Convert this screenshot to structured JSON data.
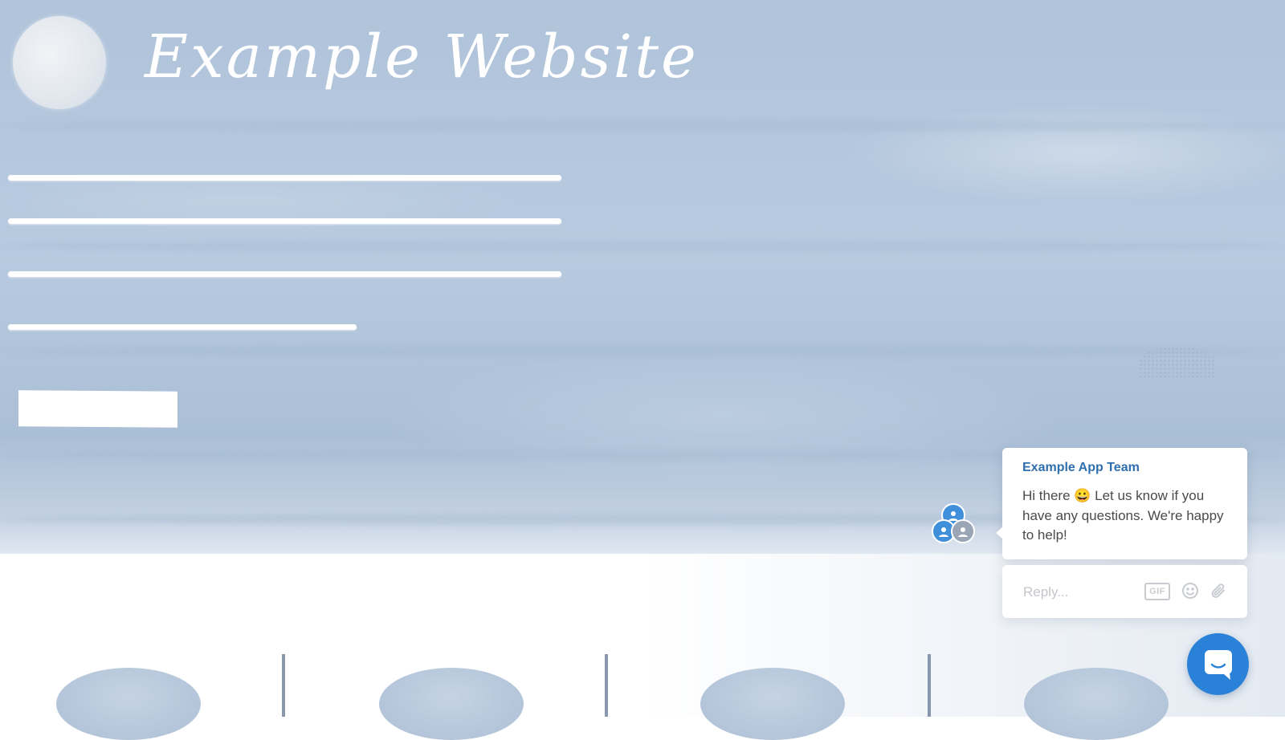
{
  "site": {
    "title": "Example Website"
  },
  "chat": {
    "team_name": "Example App Team",
    "message": "Hi there 😀 Let us know if you have any questions. We're happy to help!",
    "reply_placeholder": "Reply...",
    "gif_label": "GIF"
  },
  "icons": {
    "avatars": [
      "team-avatar-icon",
      "team-avatar-icon",
      "team-avatar-icon"
    ],
    "reply_tools": [
      "gif-icon",
      "emoji-icon",
      "attachment-icon"
    ],
    "launcher": "chat-bubble-icon"
  },
  "colors": {
    "accent": "#2a82d8",
    "team_name": "#2f6fae",
    "hero_background": "#b3c6dc"
  }
}
